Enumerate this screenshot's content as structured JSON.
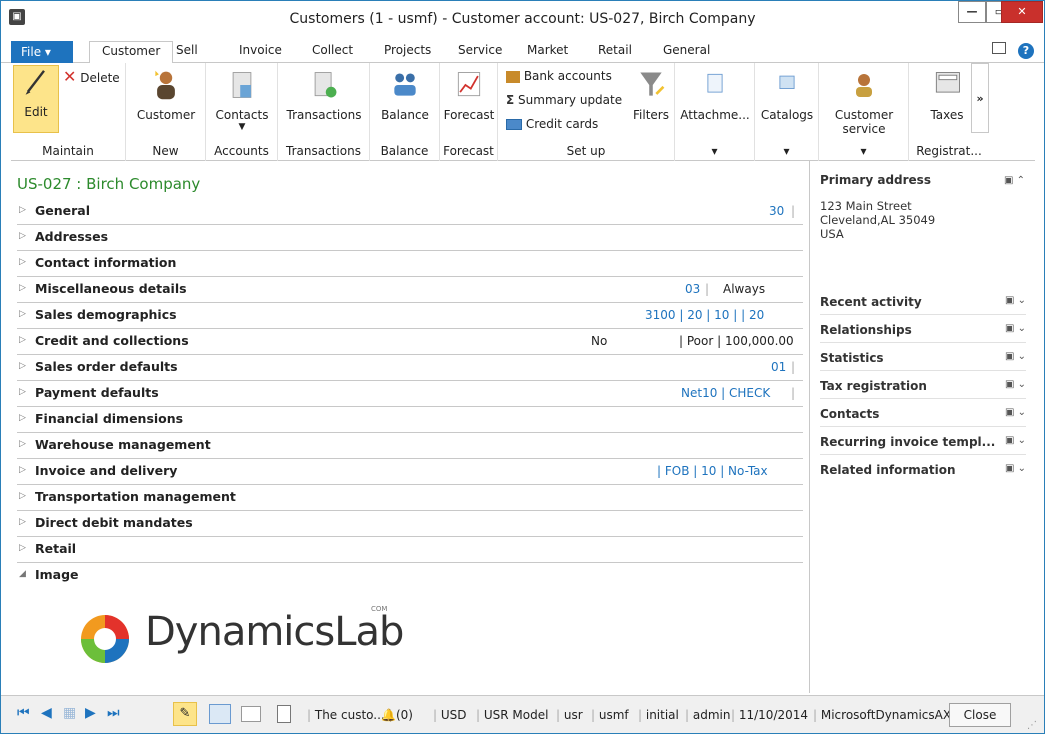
{
  "window": {
    "title": "Customers (1 - usmf) - Customer account: US-027, Birch Company",
    "app_icon": "ax-icon"
  },
  "tabs": {
    "file": "File",
    "items": [
      "Customer",
      "Sell",
      "Invoice",
      "Collect",
      "Projects",
      "Service",
      "Market",
      "Retail",
      "General"
    ]
  },
  "ribbon": {
    "edit": "Edit",
    "delete": "Delete",
    "maintain": "Maintain",
    "customer": "Customer",
    "new": "New",
    "contacts": "Contacts",
    "accounts": "Accounts",
    "transactions": "Transactions",
    "transactions_group": "Transactions",
    "balance": "Balance",
    "balance_group": "Balance",
    "forecast": "Forecast",
    "forecast_group": "Forecast",
    "bank_accounts": "Bank accounts",
    "summary_update": "Summary update",
    "credit_cards": "Credit cards",
    "filters": "Filters",
    "setup_group": "Set up",
    "attachments": "Attachme...",
    "catalogs": "Catalogs",
    "customer_service_1": "Customer",
    "customer_service_2": "service",
    "taxes": "Taxes",
    "registration": "Registrat..."
  },
  "record": {
    "title": "US-027 : Birch Company"
  },
  "fasttabs": [
    {
      "label": "General",
      "summary": "30"
    },
    {
      "label": "Addresses",
      "summary": ""
    },
    {
      "label": "Contact information",
      "summary": ""
    },
    {
      "label": "Miscellaneous details",
      "summary": "03",
      "summary2": "Always"
    },
    {
      "label": "Sales demographics",
      "summary": "3100  |  20  |  10  |  | 20"
    },
    {
      "label": "Credit and collections",
      "summary": "No",
      "summary2": "| Poor  |  100,000.00"
    },
    {
      "label": "Sales order defaults",
      "summary": "01"
    },
    {
      "label": "Payment defaults",
      "summary": "Net10  |  CHECK"
    },
    {
      "label": "Financial dimensions",
      "summary": ""
    },
    {
      "label": "Warehouse management",
      "summary": ""
    },
    {
      "label": "Invoice and delivery",
      "summary": "|  FOB  |  10  |  No-Tax"
    },
    {
      "label": "Transportation management",
      "summary": ""
    },
    {
      "label": "Direct debit mandates",
      "summary": ""
    },
    {
      "label": "Retail",
      "summary": ""
    },
    {
      "label": "Image",
      "summary": ""
    }
  ],
  "logo": {
    "text": "DynamicsLab",
    "sup": "COM"
  },
  "factbox": {
    "primary_address": "Primary address",
    "address_lines": [
      "123 Main Street",
      "Cleveland,AL 35049",
      "USA"
    ],
    "sections": [
      "Recent activity",
      "Relationships",
      "Statistics",
      "Tax registration",
      "Contacts",
      "Recurring invoice templ...",
      "Related information"
    ]
  },
  "status": {
    "message": "The custo...",
    "alerts": "(0)",
    "currency": "USD",
    "model": "USR Model",
    "layer": "usr",
    "company": "usmf",
    "partition": "initial",
    "user": "admin",
    "date": "11/10/2014",
    "instance": "MicrosoftDynamicsAX",
    "close": "Close"
  }
}
